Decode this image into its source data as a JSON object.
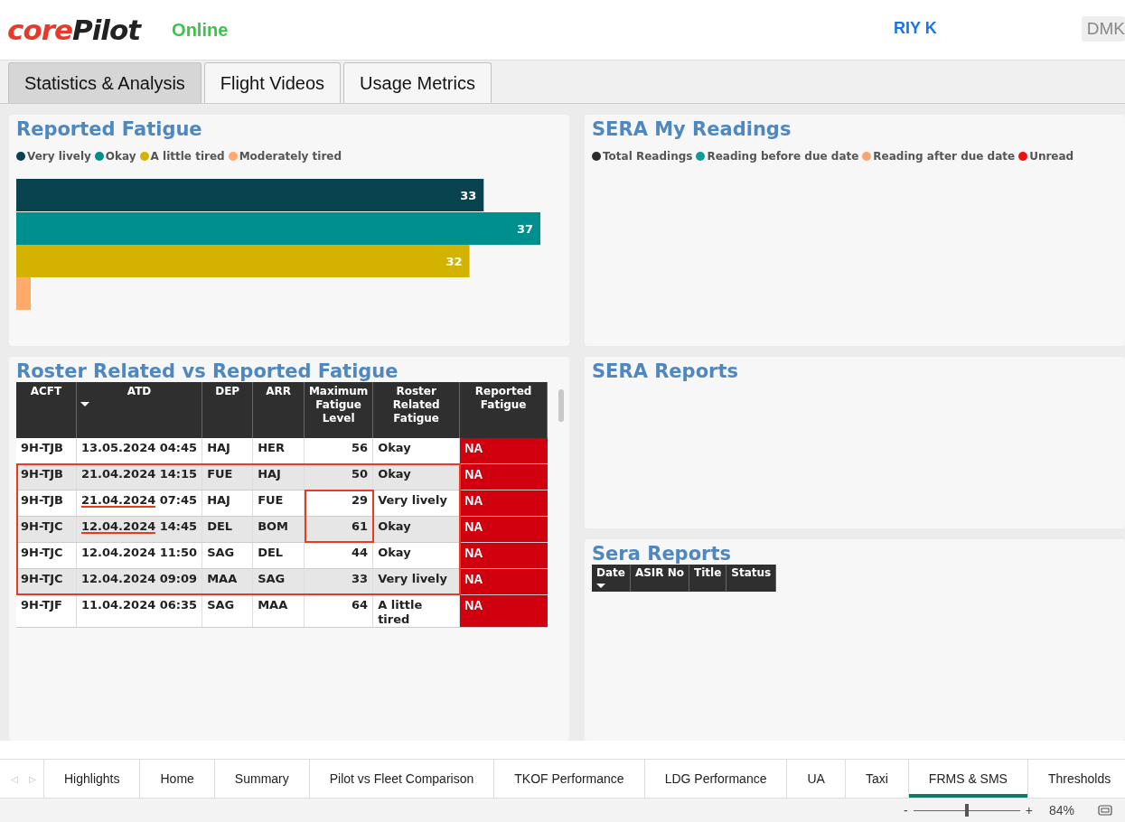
{
  "header": {
    "logo": {
      "part_1": "core",
      "part_2": "Pilot"
    },
    "status": "Online",
    "user": "RIY K",
    "badge": "DMK"
  },
  "tabs": [
    {
      "label": "Statistics & Analysis",
      "selected": true
    },
    {
      "label": "Flight Videos",
      "selected": false
    },
    {
      "label": "Usage Metrics",
      "selected": false
    }
  ],
  "reported_fatigue": {
    "title": "Reported Fatigue",
    "chart_data": {
      "type": "bar",
      "orientation": "horizontal",
      "data_labels": true,
      "series": [
        {
          "name": "Very lively",
          "color": "#08434f",
          "values": [
            33
          ]
        },
        {
          "name": "Okay",
          "color": "#008f8f",
          "values": [
            37
          ]
        },
        {
          "name": "A little tired",
          "color": "#d4b300",
          "values": [
            32
          ]
        },
        {
          "name": "Moderately tired",
          "color": "#ffa96b",
          "values": [
            null
          ]
        }
      ]
    }
  },
  "sera_my_readings": {
    "title": "SERA My Readings",
    "legend": [
      {
        "label": "Total Readings",
        "color": "#2b2b2b"
      },
      {
        "label": "Reading before due date",
        "color": "#109a98"
      },
      {
        "label": "Reading after due date",
        "color": "#f8a66d"
      },
      {
        "label": "Unread",
        "color": "#e8140f"
      }
    ]
  },
  "roster_table": {
    "title": "Roster Related vs Reported Fatigue",
    "columns": [
      {
        "label": "ACFT",
        "sorted": false
      },
      {
        "label": "ATD",
        "sorted": true
      },
      {
        "label": "DEP",
        "sorted": false
      },
      {
        "label": "ARR",
        "sorted": false
      },
      {
        "label": "Maximum Fatigue Level",
        "sorted": false
      },
      {
        "label": "Roster Related Fatigue",
        "sorted": false
      },
      {
        "label": "Reported Fatigue",
        "sorted": false
      }
    ],
    "rows": [
      {
        "acft": "9H-TJB",
        "atd": "13.05.2024 04:45",
        "dep": "HAJ",
        "arr": "HER",
        "max_level": "56",
        "roster": "Okay",
        "reported": "NA",
        "framed": false,
        "level_boxed": false,
        "date_underlined": false
      },
      {
        "acft": "9H-TJB",
        "atd": "21.04.2024 14:15",
        "dep": "FUE",
        "arr": "HAJ",
        "max_level": "50",
        "roster": "Okay",
        "reported": "NA",
        "framed": true,
        "level_boxed": false,
        "date_underlined": false
      },
      {
        "acft": "9H-TJB",
        "atd": "21.04.2024 07:45",
        "dep": "HAJ",
        "arr": "FUE",
        "max_level": "29",
        "roster": "Very lively",
        "reported": "NA",
        "framed": true,
        "level_boxed": true,
        "date_underlined": true
      },
      {
        "acft": "9H-TJC",
        "atd": "12.04.2024 14:45",
        "dep": "DEL",
        "arr": "BOM",
        "max_level": "61",
        "roster": "Okay",
        "reported": "NA",
        "framed": true,
        "level_boxed": true,
        "date_underlined": true
      },
      {
        "acft": "9H-TJC",
        "atd": "12.04.2024 11:50",
        "dep": "SAG",
        "arr": "DEL",
        "max_level": "44",
        "roster": "Okay",
        "reported": "NA",
        "framed": true,
        "level_boxed": false,
        "date_underlined": false
      },
      {
        "acft": "9H-TJC",
        "atd": "12.04.2024 09:09",
        "dep": "MAA",
        "arr": "SAG",
        "max_level": "33",
        "roster": "Very lively",
        "reported": "NA",
        "framed": true,
        "level_boxed": false,
        "date_underlined": false
      },
      {
        "acft": "9H-TJF",
        "atd": "11.04.2024 06:35",
        "dep": "SAG",
        "arr": "MAA",
        "max_level": "64",
        "roster": "A little tired",
        "reported": "NA",
        "framed": false,
        "level_boxed": false,
        "date_underlined": false
      }
    ]
  },
  "sera_reports_panel": {
    "title": "SERA Reports"
  },
  "sera_reports_table": {
    "title": "Sera Reports",
    "columns": [
      {
        "label": "Date",
        "sorted": true
      },
      {
        "label": "ASIR No",
        "sorted": false
      },
      {
        "label": "Title",
        "sorted": false
      },
      {
        "label": "Status",
        "sorted": false
      }
    ]
  },
  "page_tabs": {
    "nav": [
      "◁",
      "▷"
    ],
    "items": [
      {
        "label": "Highlights",
        "selected": false
      },
      {
        "label": "Home",
        "selected": false
      },
      {
        "label": "Summary",
        "selected": false
      },
      {
        "label": "Pilot vs Fleet Comparison",
        "selected": false
      },
      {
        "label": "TKOF Performance",
        "selected": false
      },
      {
        "label": "LDG Performance",
        "selected": false
      },
      {
        "label": "UA",
        "selected": false
      },
      {
        "label": "Taxi",
        "selected": false
      },
      {
        "label": "FRMS & SMS",
        "selected": true
      },
      {
        "label": "Thresholds",
        "selected": false
      }
    ]
  },
  "zoom": {
    "minus": "-",
    "plus": "+",
    "level": 0.5,
    "reading": "84%"
  }
}
